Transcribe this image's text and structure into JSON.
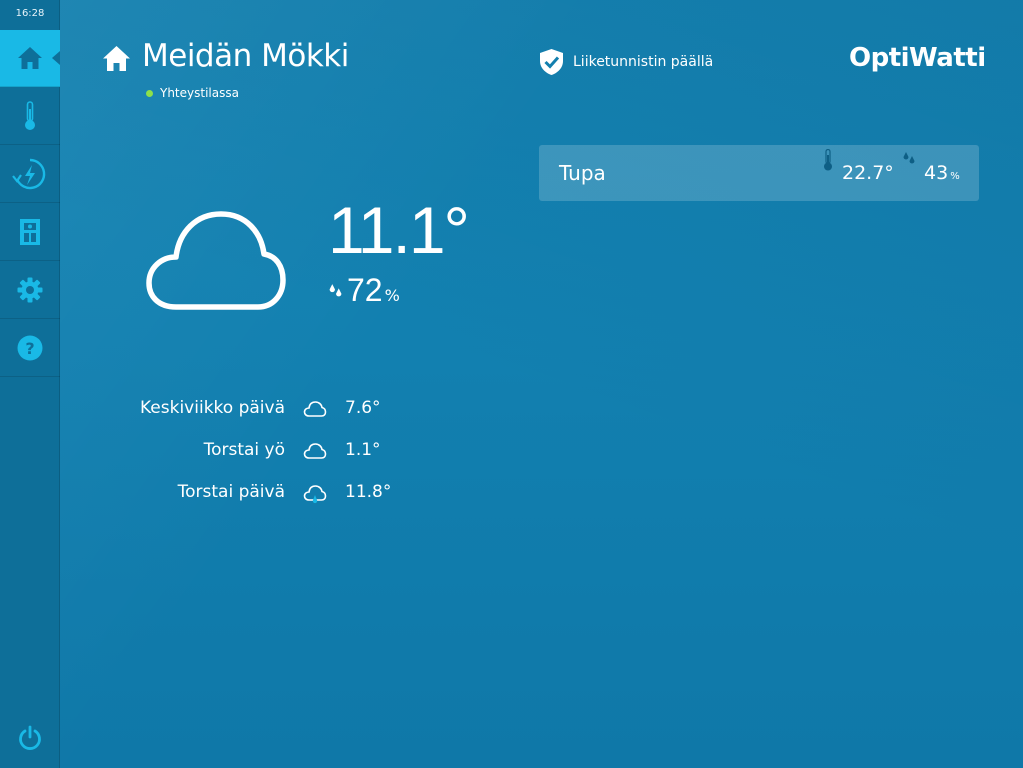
{
  "status_bar": {
    "time": "16:28"
  },
  "sidebar": {
    "items": [
      {
        "name": "home",
        "icon": "home-icon",
        "active": true
      },
      {
        "name": "temperature",
        "icon": "thermometer-icon",
        "active": false
      },
      {
        "name": "energy",
        "icon": "energy-icon",
        "active": false
      },
      {
        "name": "device",
        "icon": "device-icon",
        "active": false
      },
      {
        "name": "settings",
        "icon": "gear-icon",
        "active": false
      },
      {
        "name": "help",
        "icon": "help-icon",
        "active": false
      }
    ],
    "power_icon": "power-icon"
  },
  "header": {
    "title": "Meidän Mökki",
    "connection_status": "Yhteystilassa",
    "motion_sensor": "Liiketunnistin päällä",
    "logo": "OptiWatti"
  },
  "room": {
    "name": "Tupa",
    "temperature": "22.7°",
    "humidity": "43",
    "humidity_unit": "%"
  },
  "weather_now": {
    "temperature": "11.1°",
    "humidity": "72",
    "humidity_unit": "%",
    "icon": "cloud-icon"
  },
  "forecast": [
    {
      "label": "Keskiviikko päivä",
      "icon": "cloud-icon",
      "temperature": "7.6°"
    },
    {
      "label": "Torstai yö",
      "icon": "cloud-icon",
      "temperature": "1.1°"
    },
    {
      "label": "Torstai päivä",
      "icon": "rain-cloud-icon",
      "temperature": "11.8°"
    }
  ],
  "colors": {
    "background": "#127fae",
    "sidebar": "#0e6f99",
    "accent": "#19b9e6",
    "status_ok": "#8de04a"
  }
}
